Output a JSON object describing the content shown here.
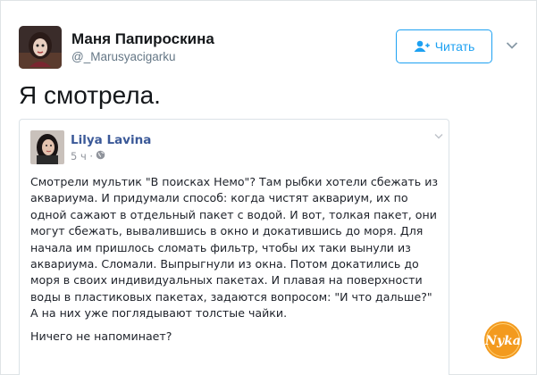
{
  "author": {
    "name": "Маня Папироскина",
    "handle": "@_Marusyacigarku"
  },
  "follow_button": {
    "label": "Читать",
    "icon": "add-person-icon"
  },
  "tweet": {
    "text": "Я смотрела."
  },
  "quoted_post": {
    "author_name": "Lilya Lavina",
    "time": "5 ч ·",
    "privacy_icon": "globe-icon",
    "lines": [
      "Смотрели мультик \"В поисках Немо\"? Там рыбки хотели сбежать из",
      "аквариума. И придумали способ: когда чистят аквариум, их по",
      "одной сажают в отдельный пакет с водой. И вот, толкая пакет, они",
      "могут сбежать, вывалившись в окно и докатившись до моря. Для",
      "начала им пришлось сломать фильтр, чтобы их таки вынули из",
      "аквариума. Сломали. Выпрыгнули из окна. Потом докатились до",
      "моря в своих индивидуальных пакетах. И плавая на поверхности",
      "воды в пластиковых пакетах, задаются вопросом: \"И что дальше?\"",
      "А на них уже поглядывают толстые чайки."
    ],
    "last_line": "Ничего не напоминает?"
  },
  "watermark": {
    "text": "Nyka"
  },
  "colors": {
    "accent": "#1da1f2",
    "fb_name": "#3b5998",
    "logo": "#f39a1e"
  }
}
